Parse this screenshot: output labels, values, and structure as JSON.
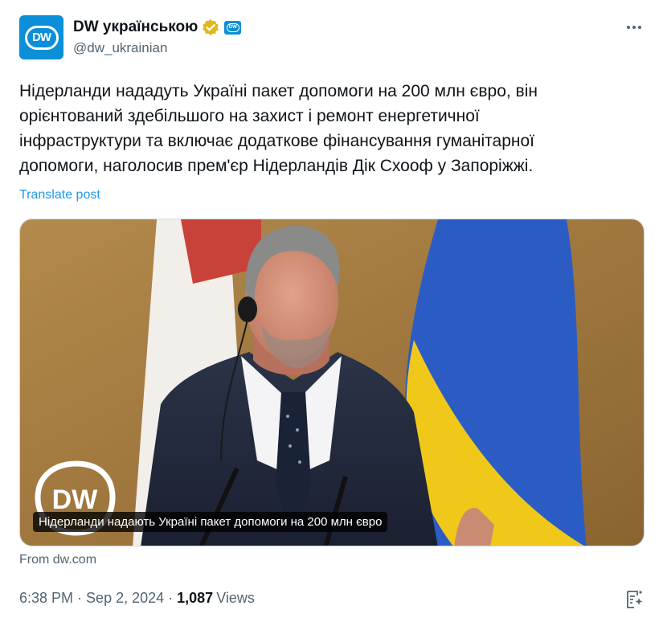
{
  "account": {
    "display_name": "DW українською",
    "handle": "@dw_ukrainian",
    "avatar_text": "DW",
    "affiliate_text": "DW"
  },
  "post": {
    "text": "Нідерланди нададуть Україні пакет допомоги на 200 млн євро, він\nорієнтований здебільшого на захист і ремонт енергетичної\nінфраструктури та включає додаткове фінансування гуманітарної\nдопомоги, наголосив прем'єр Нідерландів Дік Схооф у Запоріжжі.",
    "translate_label": "Translate post"
  },
  "card": {
    "logo_text": "DW",
    "caption": "Нідерланди надають Україні пакет допомоги на 200 млн євро",
    "source": "From dw.com"
  },
  "meta": {
    "time": "6:38 PM",
    "separator": "·",
    "date": "Sep 2, 2024",
    "views_count": "1,087",
    "views_label": "Views"
  },
  "colors": {
    "accent": "#1d9bf0",
    "brand": "#0a8fd8",
    "verified": "#e2b719",
    "muted": "#536471"
  },
  "icons": [
    "verified-badge-icon",
    "more-options-icon",
    "grok-icon"
  ]
}
